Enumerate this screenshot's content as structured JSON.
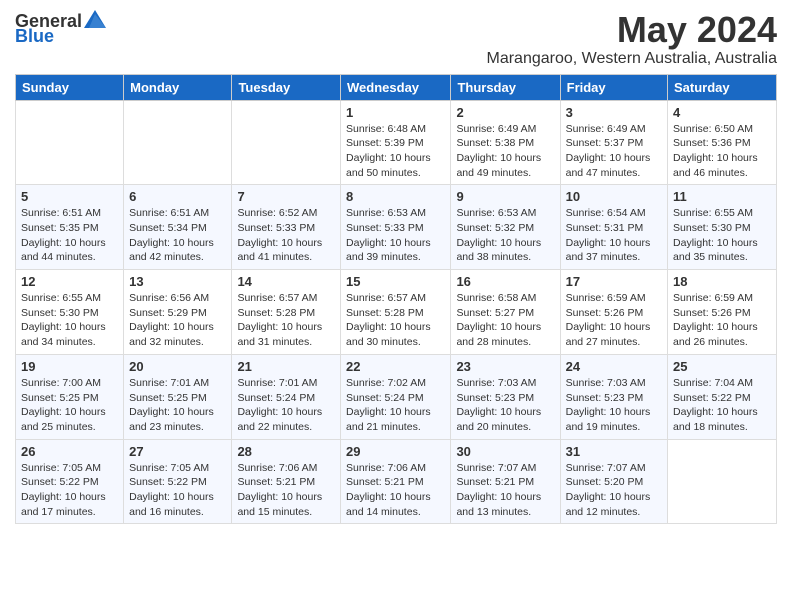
{
  "header": {
    "logo_general": "General",
    "logo_blue": "Blue",
    "month_year": "May 2024",
    "location": "Marangaroo, Western Australia, Australia"
  },
  "days_of_week": [
    "Sunday",
    "Monday",
    "Tuesday",
    "Wednesday",
    "Thursday",
    "Friday",
    "Saturday"
  ],
  "weeks": [
    [
      {
        "num": "",
        "info": ""
      },
      {
        "num": "",
        "info": ""
      },
      {
        "num": "",
        "info": ""
      },
      {
        "num": "1",
        "info": "Sunrise: 6:48 AM\nSunset: 5:39 PM\nDaylight: 10 hours\nand 50 minutes."
      },
      {
        "num": "2",
        "info": "Sunrise: 6:49 AM\nSunset: 5:38 PM\nDaylight: 10 hours\nand 49 minutes."
      },
      {
        "num": "3",
        "info": "Sunrise: 6:49 AM\nSunset: 5:37 PM\nDaylight: 10 hours\nand 47 minutes."
      },
      {
        "num": "4",
        "info": "Sunrise: 6:50 AM\nSunset: 5:36 PM\nDaylight: 10 hours\nand 46 minutes."
      }
    ],
    [
      {
        "num": "5",
        "info": "Sunrise: 6:51 AM\nSunset: 5:35 PM\nDaylight: 10 hours\nand 44 minutes."
      },
      {
        "num": "6",
        "info": "Sunrise: 6:51 AM\nSunset: 5:34 PM\nDaylight: 10 hours\nand 42 minutes."
      },
      {
        "num": "7",
        "info": "Sunrise: 6:52 AM\nSunset: 5:33 PM\nDaylight: 10 hours\nand 41 minutes."
      },
      {
        "num": "8",
        "info": "Sunrise: 6:53 AM\nSunset: 5:33 PM\nDaylight: 10 hours\nand 39 minutes."
      },
      {
        "num": "9",
        "info": "Sunrise: 6:53 AM\nSunset: 5:32 PM\nDaylight: 10 hours\nand 38 minutes."
      },
      {
        "num": "10",
        "info": "Sunrise: 6:54 AM\nSunset: 5:31 PM\nDaylight: 10 hours\nand 37 minutes."
      },
      {
        "num": "11",
        "info": "Sunrise: 6:55 AM\nSunset: 5:30 PM\nDaylight: 10 hours\nand 35 minutes."
      }
    ],
    [
      {
        "num": "12",
        "info": "Sunrise: 6:55 AM\nSunset: 5:30 PM\nDaylight: 10 hours\nand 34 minutes."
      },
      {
        "num": "13",
        "info": "Sunrise: 6:56 AM\nSunset: 5:29 PM\nDaylight: 10 hours\nand 32 minutes."
      },
      {
        "num": "14",
        "info": "Sunrise: 6:57 AM\nSunset: 5:28 PM\nDaylight: 10 hours\nand 31 minutes."
      },
      {
        "num": "15",
        "info": "Sunrise: 6:57 AM\nSunset: 5:28 PM\nDaylight: 10 hours\nand 30 minutes."
      },
      {
        "num": "16",
        "info": "Sunrise: 6:58 AM\nSunset: 5:27 PM\nDaylight: 10 hours\nand 28 minutes."
      },
      {
        "num": "17",
        "info": "Sunrise: 6:59 AM\nSunset: 5:26 PM\nDaylight: 10 hours\nand 27 minutes."
      },
      {
        "num": "18",
        "info": "Sunrise: 6:59 AM\nSunset: 5:26 PM\nDaylight: 10 hours\nand 26 minutes."
      }
    ],
    [
      {
        "num": "19",
        "info": "Sunrise: 7:00 AM\nSunset: 5:25 PM\nDaylight: 10 hours\nand 25 minutes."
      },
      {
        "num": "20",
        "info": "Sunrise: 7:01 AM\nSunset: 5:25 PM\nDaylight: 10 hours\nand 23 minutes."
      },
      {
        "num": "21",
        "info": "Sunrise: 7:01 AM\nSunset: 5:24 PM\nDaylight: 10 hours\nand 22 minutes."
      },
      {
        "num": "22",
        "info": "Sunrise: 7:02 AM\nSunset: 5:24 PM\nDaylight: 10 hours\nand 21 minutes."
      },
      {
        "num": "23",
        "info": "Sunrise: 7:03 AM\nSunset: 5:23 PM\nDaylight: 10 hours\nand 20 minutes."
      },
      {
        "num": "24",
        "info": "Sunrise: 7:03 AM\nSunset: 5:23 PM\nDaylight: 10 hours\nand 19 minutes."
      },
      {
        "num": "25",
        "info": "Sunrise: 7:04 AM\nSunset: 5:22 PM\nDaylight: 10 hours\nand 18 minutes."
      }
    ],
    [
      {
        "num": "26",
        "info": "Sunrise: 7:05 AM\nSunset: 5:22 PM\nDaylight: 10 hours\nand 17 minutes."
      },
      {
        "num": "27",
        "info": "Sunrise: 7:05 AM\nSunset: 5:22 PM\nDaylight: 10 hours\nand 16 minutes."
      },
      {
        "num": "28",
        "info": "Sunrise: 7:06 AM\nSunset: 5:21 PM\nDaylight: 10 hours\nand 15 minutes."
      },
      {
        "num": "29",
        "info": "Sunrise: 7:06 AM\nSunset: 5:21 PM\nDaylight: 10 hours\nand 14 minutes."
      },
      {
        "num": "30",
        "info": "Sunrise: 7:07 AM\nSunset: 5:21 PM\nDaylight: 10 hours\nand 13 minutes."
      },
      {
        "num": "31",
        "info": "Sunrise: 7:07 AM\nSunset: 5:20 PM\nDaylight: 10 hours\nand 12 minutes."
      },
      {
        "num": "",
        "info": ""
      }
    ]
  ]
}
